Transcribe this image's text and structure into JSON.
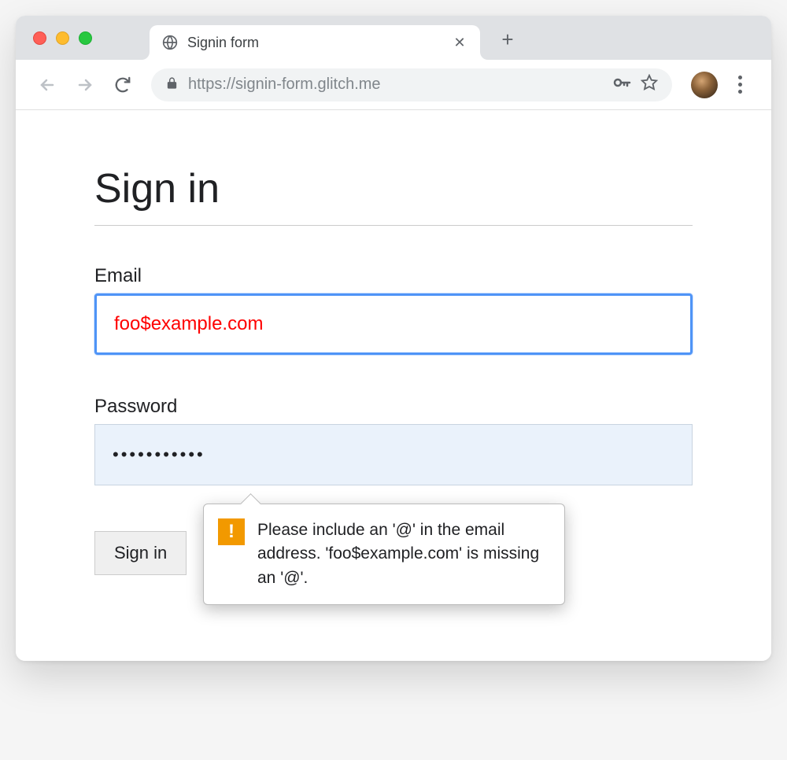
{
  "browser": {
    "tab_title": "Signin form",
    "url": "https://signin-form.glitch.me"
  },
  "page": {
    "heading": "Sign in",
    "email_label": "Email",
    "email_value": "foo$example.com",
    "password_label": "Password",
    "password_value": "•••••••••••",
    "submit_label": "Sign in"
  },
  "tooltip": {
    "message": "Please include an '@' in the email address. 'foo$example.com' is missing an '@'."
  }
}
